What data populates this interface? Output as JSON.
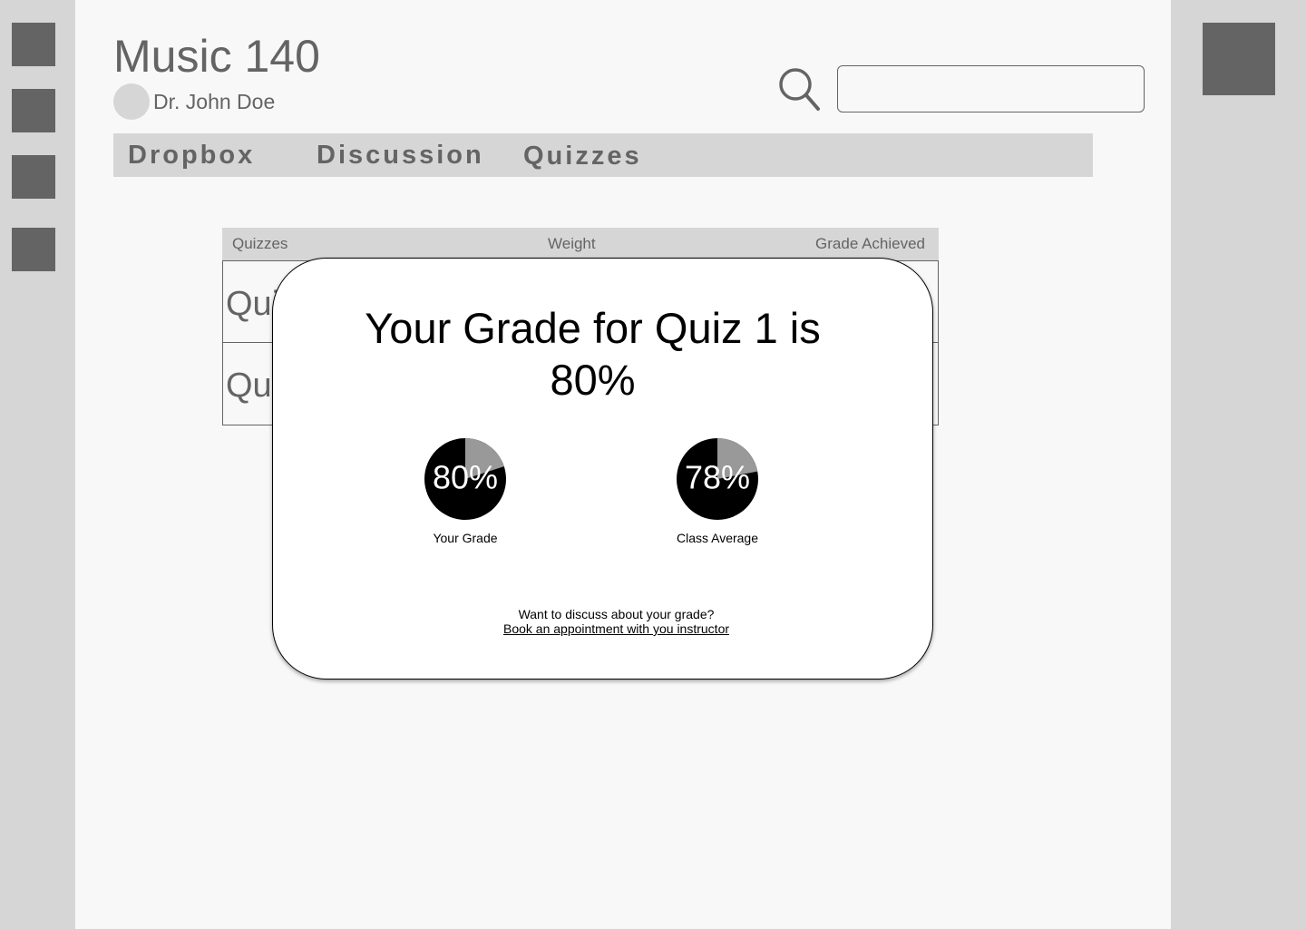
{
  "course": {
    "title": "Music 140",
    "instructor": "Dr. John Doe"
  },
  "search": {
    "value": "",
    "placeholder": ""
  },
  "nav": {
    "tabs": [
      {
        "label": "Dropbox"
      },
      {
        "label": "Discussion"
      },
      {
        "label": "Quizzes"
      }
    ]
  },
  "table": {
    "headers": [
      "Quizzes",
      "Weight",
      "Grade Achieved"
    ],
    "rows": [
      {
        "label": "Qui"
      },
      {
        "label": "Qui"
      }
    ]
  },
  "modal": {
    "title": "Your Grade for Quiz 1 is 80%",
    "footer_prompt": "Want to discuss about your grade?",
    "footer_link": "Book an appointment with you instructor"
  },
  "chart_data": [
    {
      "type": "pie",
      "label": "80%",
      "caption": "Your Grade",
      "value": 80,
      "colors": {
        "filled": "#000000",
        "remaining": "#999999"
      }
    },
    {
      "type": "pie",
      "label": "78%",
      "caption": "Class Average",
      "value": 78,
      "colors": {
        "filled": "#000000",
        "remaining": "#999999"
      }
    }
  ],
  "colors": {
    "rail": "#d6d6d6",
    "canvas": "#f8f8f8",
    "placeholder_block": "#646464",
    "text": "#646464"
  },
  "icons": {
    "search": "search-icon",
    "avatar": "avatar"
  }
}
